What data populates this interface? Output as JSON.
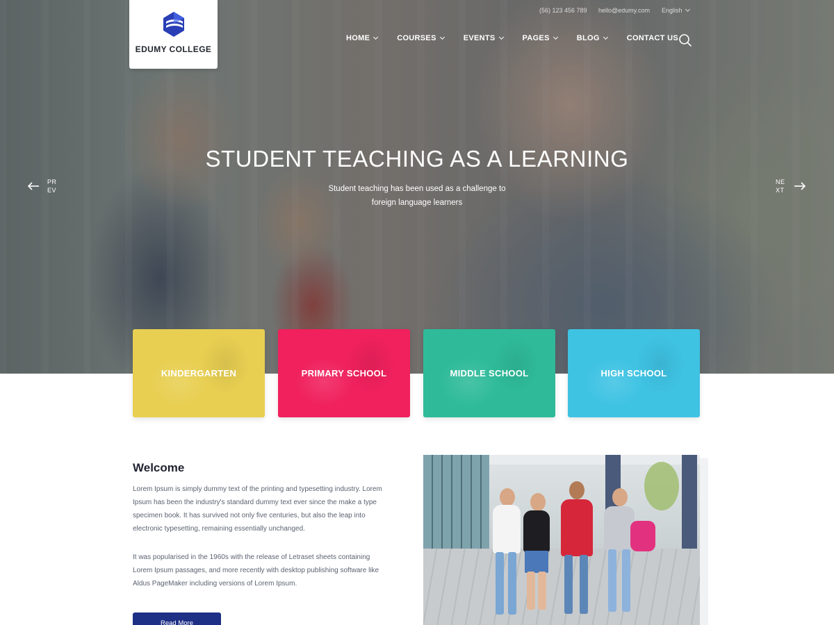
{
  "brand": {
    "name": "EDUMY COLLEGE",
    "accent": "#2a3fb5"
  },
  "topbar": {
    "phone": "(56) 123 456 789",
    "email": "hello@edumy.com",
    "language": "English"
  },
  "nav": [
    {
      "label": "HOME",
      "has_dropdown": true
    },
    {
      "label": "COURSES",
      "has_dropdown": true
    },
    {
      "label": "EVENTS",
      "has_dropdown": true
    },
    {
      "label": "PAGES",
      "has_dropdown": true
    },
    {
      "label": "BLOG",
      "has_dropdown": true
    },
    {
      "label": "CONTACT US",
      "has_dropdown": false
    }
  ],
  "search": {
    "icon": "search-icon"
  },
  "hero": {
    "title": "STUDENT TEACHING AS A LEARNING",
    "subtitle": "Student teaching has been used as a challenge to foreign language learners",
    "prev_label": "PREV",
    "next_label": "NEXT"
  },
  "categories": [
    {
      "label": "KINDERGARTEN",
      "color": "#e8cf52"
    },
    {
      "label": "PRIMARY SCHOOL",
      "color": "#f0215d"
    },
    {
      "label": "MIDDLE SCHOOL",
      "color": "#2fbb9a"
    },
    {
      "label": "HIGH SCHOOL",
      "color": "#3fc3e3"
    }
  ],
  "welcome": {
    "title": "Welcome",
    "paragraph_1": "Lorem Ipsum is simply dummy text of the printing and typesetting industry. Lorem Ipsum has been the industry's standard dummy text ever since the make a type specimen book. It has survived not only five centuries, but also the leap into electronic typesetting, remaining essentially unchanged.",
    "paragraph_2": "It was popularised in the 1960s with the release of Letraset sheets containing Lorem Ipsum passages, and more recently with desktop publishing software like Aldus PageMaker including versions of Lorem Ipsum.",
    "button_label": "Read More",
    "button_color": "#1e2f86"
  }
}
